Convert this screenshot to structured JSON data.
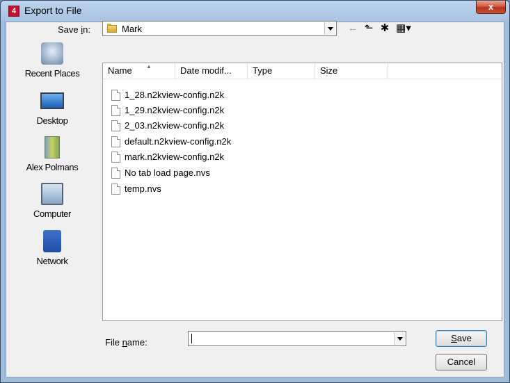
{
  "window": {
    "title": "Export to File",
    "close_glyph": "x",
    "app_icon_glyph": "4"
  },
  "toolbar": {
    "save_in_label_pre": "Save ",
    "save_in_label_key": "i",
    "save_in_label_post": "n:",
    "save_in_value": "Mark",
    "back_glyph": "←",
    "up_glyph": "⬑",
    "new_folder_glyph": "✱",
    "views_glyph": "▦▾"
  },
  "places": [
    {
      "label": "Recent Places",
      "icon": "recent-places-icon"
    },
    {
      "label": "Desktop",
      "icon": "desktop-icon"
    },
    {
      "label": "Alex Polmans",
      "icon": "user-folder-icon"
    },
    {
      "label": "Computer",
      "icon": "computer-icon"
    },
    {
      "label": "Network",
      "icon": "network-icon"
    }
  ],
  "columns": {
    "name": "Name",
    "date": "Date modif...",
    "type": "Type",
    "size": "Size"
  },
  "files": [
    "1_28.n2kview-config.n2k",
    "1_29.n2kview-config.n2k",
    "2_03.n2kview-config.n2k",
    "default.n2kview-config.n2k",
    "mark.n2kview-config.n2k",
    "No tab load page.nvs",
    "temp.nvs"
  ],
  "footer": {
    "file_name_label_pre": "File ",
    "file_name_label_key": "n",
    "file_name_label_post": "ame:",
    "file_name_value": "",
    "save_key": "S",
    "save_rest": "ave",
    "cancel_label": "Cancel"
  }
}
